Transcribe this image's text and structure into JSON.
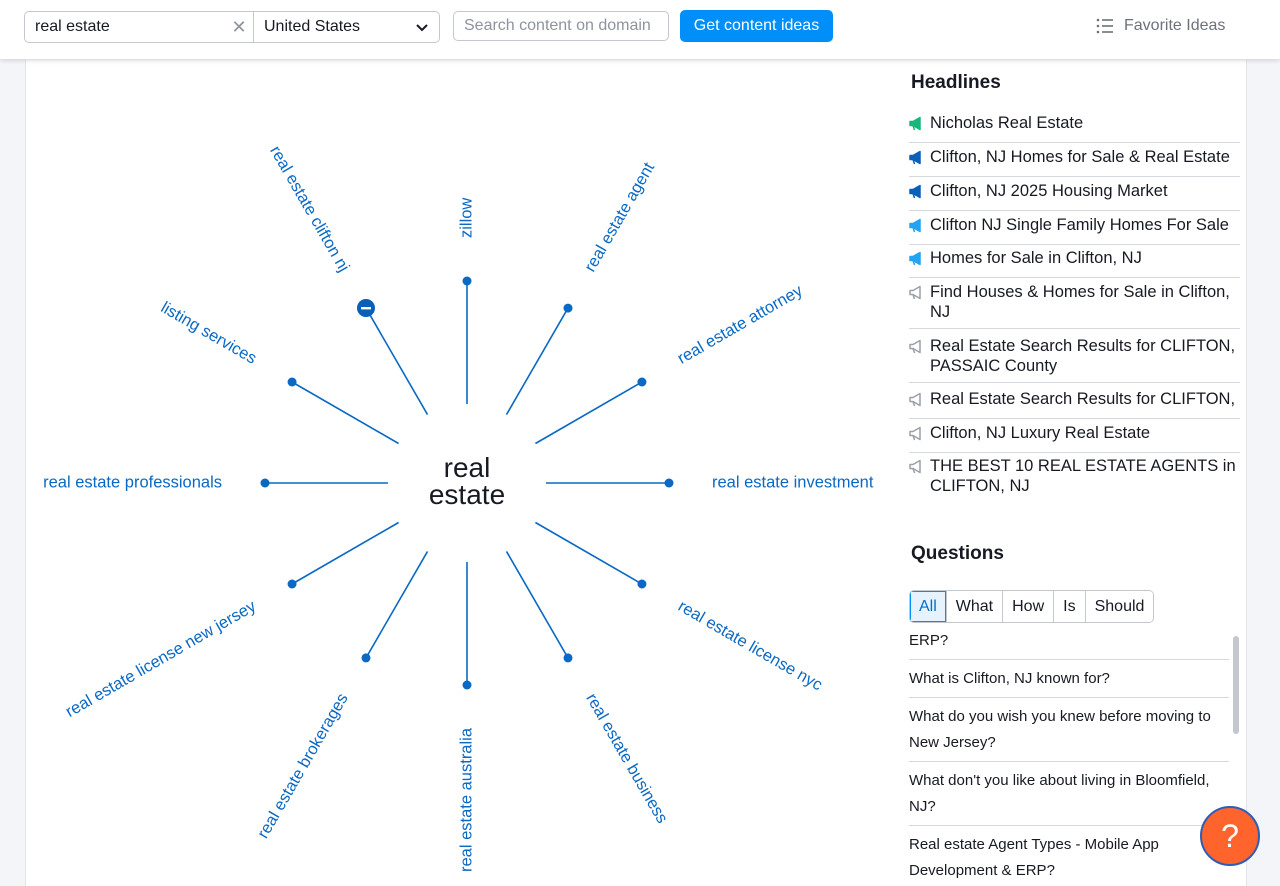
{
  "search": {
    "keyword_value": "real estate",
    "clear_icon": "close-icon",
    "country": "United States",
    "domain_placeholder": "Search content on domain",
    "submit_label": "Get content ideas"
  },
  "favorites": {
    "label": "Favorite Ideas",
    "icon": "list-icon"
  },
  "mindmap": {
    "center": "real\nestate",
    "topics": [
      "zillow",
      "real estate agent",
      "real estate attorney",
      "real estate investment",
      "real estate license nyc",
      "real estate business",
      "real estate australia",
      "real estate brokerages",
      "real estate license new jersey",
      "real estate professionals",
      "listing services",
      "real estate clifton nj"
    ],
    "accent_color": "#0a69c4"
  },
  "headlines": {
    "title": "Headlines",
    "items": [
      {
        "text": "Nicholas Real Estate",
        "icon_color": "#18b67a"
      },
      {
        "text": "Clifton, NJ Homes for Sale & Real Estate",
        "icon_color": "#0a5fb8"
      },
      {
        "text": "Clifton, NJ 2025 Housing Market",
        "icon_color": "#0a5fb8"
      },
      {
        "text": "Clifton NJ Single Family Homes For Sale",
        "icon_color": "#23a3f0"
      },
      {
        "text": "Homes for Sale in Clifton, NJ",
        "icon_color": "#23a3f0"
      },
      {
        "text": "Find Houses & Homes for Sale in Clifton, NJ",
        "icon_color": "#9ba0a8"
      },
      {
        "text": "Real Estate Search Results for CLIFTON, PASSAIC County",
        "icon_color": "#9ba0a8"
      },
      {
        "text": "Real Estate Search Results for CLIFTON,",
        "icon_color": "#9ba0a8"
      },
      {
        "text": "Clifton, NJ Luxury Real Estate",
        "icon_color": "#9ba0a8"
      },
      {
        "text": "THE BEST 10 REAL ESTATE AGENTS in CLIFTON, NJ",
        "icon_color": "#9ba0a8"
      }
    ]
  },
  "questions": {
    "title": "Questions",
    "tabs": [
      "All",
      "What",
      "How",
      "Is",
      "Should"
    ],
    "active_tab": "All",
    "items": [
      "ERP?",
      "What is Clifton, NJ known for?",
      "What do you wish you knew before moving to New Jersey?",
      "What don't you like about living in Bloomfield, NJ?",
      "Real estate Agent Types - Mobile App Development & ERP?"
    ]
  },
  "help": {
    "label": "?"
  }
}
